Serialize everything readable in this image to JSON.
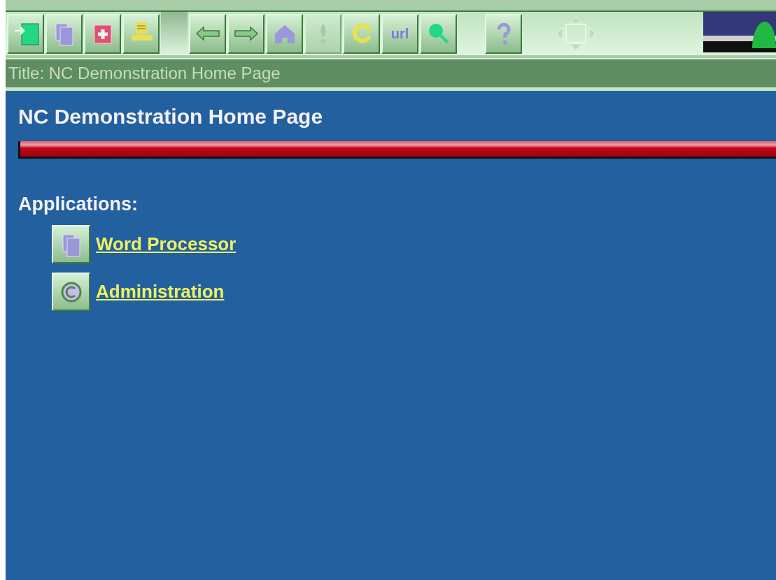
{
  "toolbar": {
    "groups": [
      [
        {
          "kind": "login",
          "disabled": false
        },
        {
          "kind": "documents",
          "disabled": false
        },
        {
          "kind": "add",
          "disabled": false
        },
        {
          "kind": "print",
          "disabled": false
        }
      ],
      [
        {
          "kind": "back",
          "disabled": false
        },
        {
          "kind": "forward",
          "disabled": false
        },
        {
          "kind": "home",
          "disabled": false
        },
        {
          "kind": "alert",
          "disabled": true
        },
        {
          "kind": "reload",
          "disabled": false
        },
        {
          "kind": "url",
          "label": "url",
          "disabled": false
        },
        {
          "kind": "search",
          "disabled": false
        }
      ],
      [
        {
          "kind": "help",
          "disabled": false
        }
      ]
    ]
  },
  "title_bar": {
    "text": "Title: NC Demonstration Home Page"
  },
  "page": {
    "heading": "NC Demonstration Home Page",
    "section": "Applications:",
    "links": [
      {
        "kind": "documents",
        "label": "Word Processor"
      },
      {
        "kind": "admin",
        "label": "Administration"
      }
    ]
  }
}
